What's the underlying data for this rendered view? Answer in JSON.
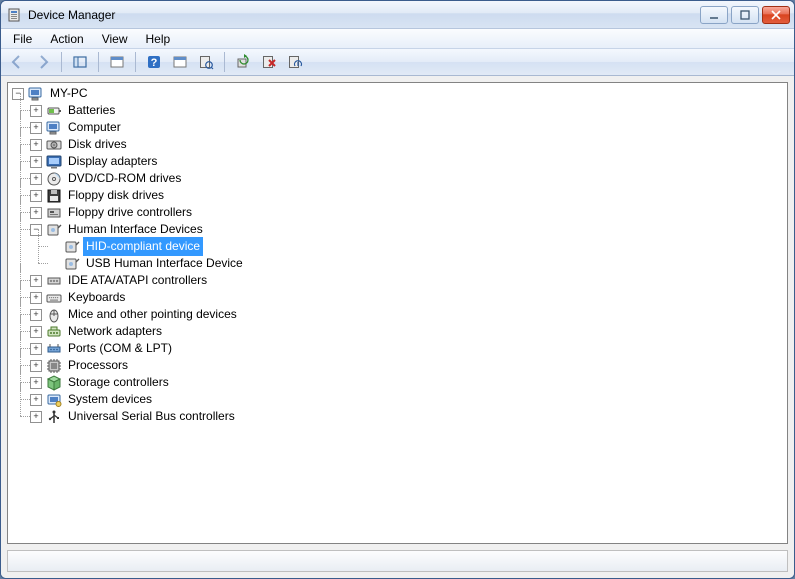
{
  "window": {
    "title": "Device Manager"
  },
  "menu": {
    "file": "File",
    "action": "Action",
    "view": "View",
    "help": "Help"
  },
  "expanders": {
    "minus": "−",
    "plus": "+"
  },
  "tree": {
    "root": "MY-PC",
    "batteries": "Batteries",
    "computer": "Computer",
    "disk_drives": "Disk drives",
    "display_adapters": "Display adapters",
    "dvd": "DVD/CD-ROM drives",
    "floppy_disk_drives": "Floppy disk drives",
    "floppy_drive_controllers": "Floppy drive controllers",
    "hid": "Human Interface Devices",
    "hid_compliant": "HID-compliant device",
    "usb_hid": "USB Human Interface Device",
    "ide": "IDE ATA/ATAPI controllers",
    "keyboards": "Keyboards",
    "mice": "Mice and other pointing devices",
    "network": "Network adapters",
    "ports": "Ports (COM & LPT)",
    "processors": "Processors",
    "storage_controllers": "Storage controllers",
    "system_devices": "System devices",
    "usb_controllers": "Universal Serial Bus controllers"
  }
}
